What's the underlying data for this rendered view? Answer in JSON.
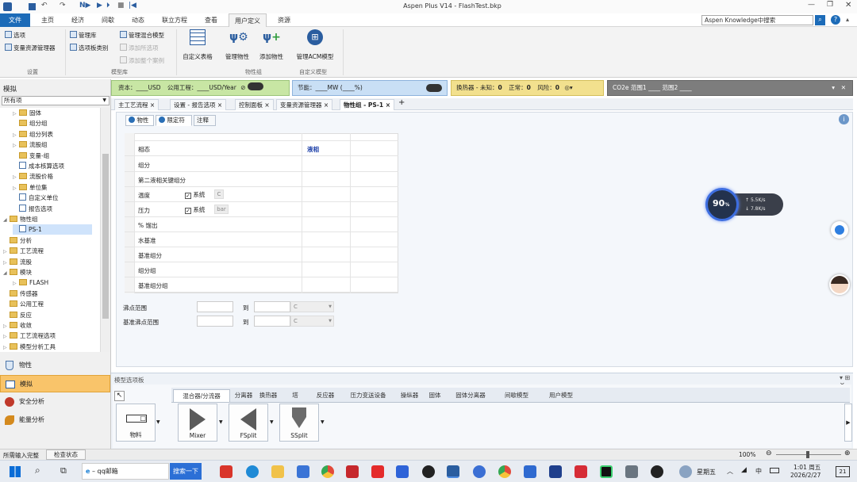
{
  "window": {
    "title": "Aspen Plus V14 - FlashTest.bkp"
  },
  "ribbon_tabs": [
    "文件",
    "主页",
    "经济",
    "间歇",
    "动态",
    "联立方程",
    "查看",
    "用户定义",
    "资源"
  ],
  "search": {
    "placeholder": "Aspen Knowledge中搜索"
  },
  "ribbon": {
    "settings": {
      "title": "设置",
      "items": [
        "选项",
        "变量资源管理器"
      ]
    },
    "model_library": {
      "title": "模型库",
      "items": [
        "管理库",
        "选项板类别",
        "管理混合模型",
        "添加所选项",
        "添加整个案例"
      ]
    },
    "custom_model": {
      "title": "自定义模型",
      "items": [
        "自定义表格",
        "管理物性",
        "添加物性",
        "管理ACM模型"
      ],
      "sub_title": "物性组"
    }
  },
  "left_pane": {
    "title": "模拟",
    "filter": "所有项",
    "tree": [
      {
        "label": "固体",
        "kind": "folder",
        "level": 2,
        "exp": "▷"
      },
      {
        "label": "组分组",
        "kind": "folder",
        "level": 2,
        "exp": ""
      },
      {
        "label": "组分列表",
        "kind": "folder",
        "level": 2,
        "exp": "▷"
      },
      {
        "label": "流股组",
        "kind": "folder",
        "level": 2,
        "exp": "▷"
      },
      {
        "label": "变量-组",
        "kind": "folder",
        "level": 2,
        "exp": ""
      },
      {
        "label": "成本核算选项",
        "kind": "doc",
        "level": 2,
        "exp": ""
      },
      {
        "label": "流股价格",
        "kind": "folder",
        "level": 2,
        "exp": "▷"
      },
      {
        "label": "单位集",
        "kind": "folder",
        "level": 2,
        "exp": "▷"
      },
      {
        "label": "自定义单位",
        "kind": "doc",
        "level": 2,
        "exp": ""
      },
      {
        "label": "报告选项",
        "kind": "doc",
        "level": 2,
        "exp": ""
      },
      {
        "label": "物性组",
        "kind": "folder",
        "level": 1,
        "exp": "◢"
      },
      {
        "label": "PS-1",
        "kind": "doc",
        "level": 2,
        "exp": ""
      },
      {
        "label": "分析",
        "kind": "folder",
        "level": 1,
        "exp": ""
      },
      {
        "label": "工艺流程",
        "kind": "folder",
        "level": 1,
        "exp": "▷"
      },
      {
        "label": "流股",
        "kind": "folder",
        "level": 1,
        "exp": "▷"
      },
      {
        "label": "模块",
        "kind": "folder",
        "level": 1,
        "exp": "◢"
      },
      {
        "label": "FLASH",
        "kind": "folder",
        "level": 2,
        "exp": "▷"
      },
      {
        "label": "传感器",
        "kind": "folder",
        "level": 1,
        "exp": ""
      },
      {
        "label": "公用工程",
        "kind": "folder",
        "level": 1,
        "exp": ""
      },
      {
        "label": "反应",
        "kind": "folder",
        "level": 1,
        "exp": ""
      },
      {
        "label": "收敛",
        "kind": "folder",
        "level": 1,
        "exp": "▷"
      },
      {
        "label": "工艺流程选项",
        "kind": "folder",
        "level": 1,
        "exp": "▷"
      },
      {
        "label": "模型分析工具",
        "kind": "folder",
        "level": 1,
        "exp": "▷"
      }
    ],
    "nav": [
      "物性",
      "模拟",
      "安全分析",
      "能量分析"
    ]
  },
  "info_bar": {
    "capital": "资本：____USD",
    "utility": "公用工程：____USD/Year",
    "energy": "节能：____MW   (____%)",
    "heat_ex": "换热器 - 未知：",
    "hx_unknown": "0",
    "hx_normal_label": "正常：",
    "hx_normal": "0",
    "hx_risk_label": "风险：",
    "hx_risk": "0",
    "co2": "CO2e 范围1 ____ 范围2 ____"
  },
  "doc_tabs": [
    "主工艺流程",
    "设置 - 报告选项",
    "控制面板",
    "变量资源管理器",
    "物性组 - PS-1"
  ],
  "form": {
    "tabs": [
      "物性",
      "限定符",
      "注释"
    ],
    "col_header": "液相",
    "rows": [
      "相态",
      "组分",
      "第二液相关键组分",
      "温度",
      "压力",
      "% 馏出",
      "水基准",
      "基准组分",
      "组分组",
      "基准组分组"
    ],
    "temp": {
      "check": "✓",
      "label": "系统",
      "unit": "C"
    },
    "pressure": {
      "check": "✓",
      "label": "系统",
      "unit": "bar"
    },
    "bubble": {
      "label": "沸点范围",
      "to": "到",
      "unit": "C"
    },
    "base_bubble": {
      "label": "基准沸点范围",
      "to": "到",
      "unit": "C"
    }
  },
  "widget": {
    "percent": "90",
    "unit": "%",
    "up": "5.5K/s",
    "down": "7.8K/s"
  },
  "model_palette": {
    "title": "模型选项板",
    "tabs": [
      "混合器/分流器",
      "分离器",
      "换热器",
      "塔",
      "反应器",
      "压力变送设备",
      "操纵器",
      "固体",
      "固体分离器",
      "间歇模型",
      "用户模型"
    ],
    "items": [
      "物料",
      "Mixer",
      "FSplit",
      "SSplit"
    ]
  },
  "status": {
    "left": "所需输入完整",
    "check": "检查状态",
    "zoom": "100%"
  },
  "taskbar": {
    "search": "qq邮箱",
    "search_btn": "搜索一下",
    "weekday": "星期五",
    "time": "1:01 周五",
    "date": "2026/2/27",
    "lang": "中",
    "notify": "21"
  }
}
